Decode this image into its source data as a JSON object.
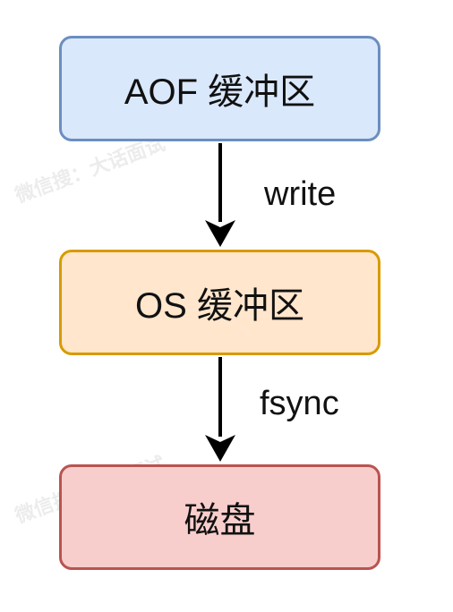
{
  "nodes": [
    {
      "label": "AOF 缓冲区",
      "fill": "#dae8fc",
      "stroke": "#6c8ebf"
    },
    {
      "label": "OS 缓冲区",
      "fill": "#ffe6cc",
      "stroke": "#d79b00"
    },
    {
      "label": "磁盘",
      "fill": "#f8cecc",
      "stroke": "#b85450"
    }
  ],
  "edges": [
    {
      "from": "AOF 缓冲区",
      "to": "OS 缓冲区",
      "label": "write"
    },
    {
      "from": "OS 缓冲区",
      "to": "磁盘",
      "label": "fsync"
    }
  ],
  "watermarks": [
    "微信搜：大话面试",
    "微信搜：大话面试"
  ]
}
